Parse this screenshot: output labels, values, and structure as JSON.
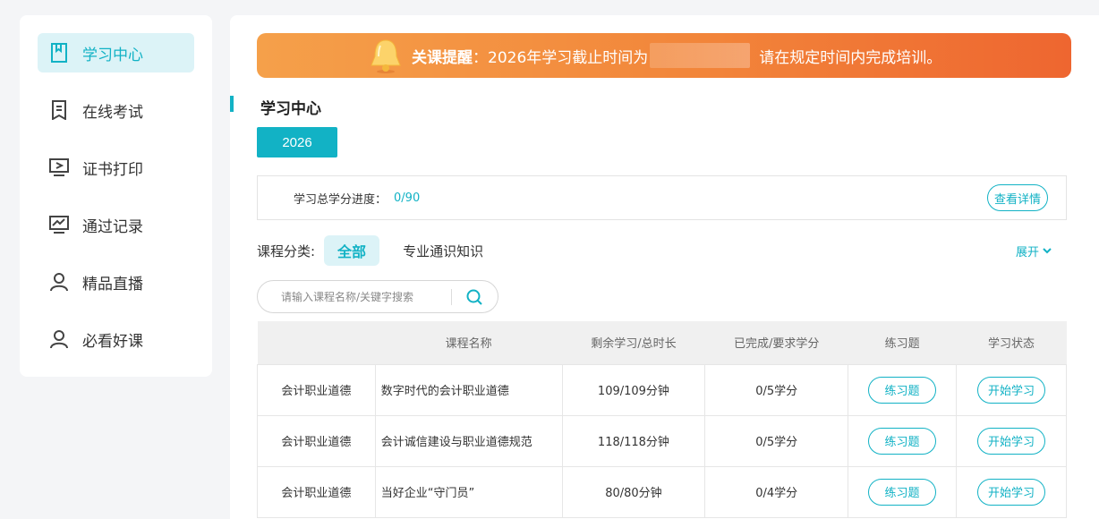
{
  "sidebar": {
    "items": [
      {
        "label": "学习中心",
        "icon": "book-icon",
        "active": true
      },
      {
        "label": "在线考试",
        "icon": "exam-icon"
      },
      {
        "label": "证书打印",
        "icon": "certificate-icon"
      },
      {
        "label": "通过记录",
        "icon": "chart-icon"
      },
      {
        "label": "精品直播",
        "icon": "user-icon"
      },
      {
        "label": "必看好课",
        "icon": "user-icon"
      }
    ]
  },
  "notice": {
    "title": "关课提醒",
    "text_before": "：2026年学习截止时间为",
    "text_after": "请在规定时间内完成培训。",
    "icon": "bell-icon"
  },
  "main": {
    "section_title": "学习中心",
    "year": "2026"
  },
  "progress": {
    "label": "学习总学分进度：",
    "value": "0/90",
    "detail_button": "查看详情"
  },
  "category": {
    "label": "课程分类:",
    "items": [
      "全部",
      "专业通识知识"
    ],
    "expand": "展开"
  },
  "search": {
    "placeholder": "请输入课程名称/关键字搜索"
  },
  "table": {
    "headers": [
      "",
      "课程名称",
      "剩余学习/总时长",
      "已完成/要求学分",
      "练习题",
      "学习状态"
    ],
    "rows": [
      {
        "category": "会计职业道德",
        "name": "数字时代的会计职业道德",
        "time": "109/109分钟",
        "credit": "0/5学分",
        "exercise": "练习题",
        "status": "开始学习"
      },
      {
        "category": "会计职业道德",
        "name": "会计诚信建设与职业道德规范",
        "time": "118/118分钟",
        "credit": "0/5学分",
        "exercise": "练习题",
        "status": "开始学习"
      },
      {
        "category": "会计职业道德",
        "name": "当好企业“守门员”",
        "time": "80/80分钟",
        "credit": "0/4学分",
        "exercise": "练习题",
        "status": "开始学习"
      }
    ]
  },
  "colors": {
    "accent": "#12b2c5",
    "notice_start": "#f5a04a",
    "notice_end": "#ee6630"
  }
}
